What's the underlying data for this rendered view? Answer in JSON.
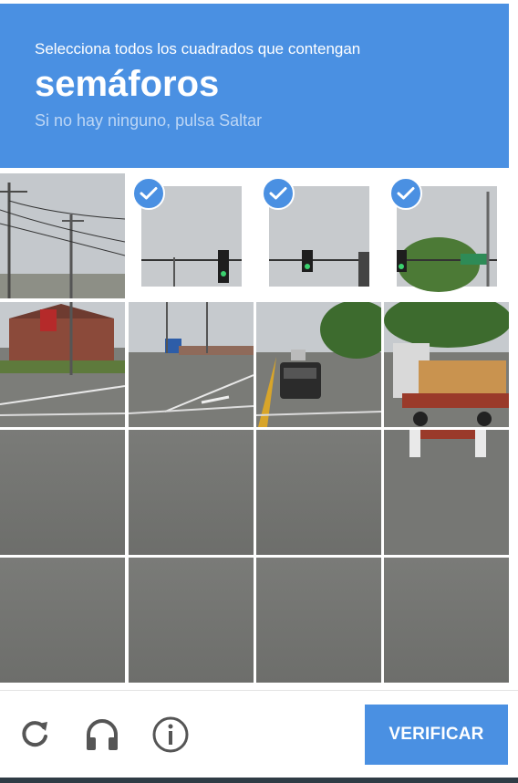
{
  "header": {
    "instruction": "Selecciona todos los cuadrados que contengan",
    "target": "semáforos",
    "hint": "Si no hay ninguno, pulsa Saltar"
  },
  "grid": {
    "rows": 4,
    "cols": 4,
    "selected_tiles": [
      1,
      2,
      3
    ]
  },
  "icons": {
    "reload": "reload-icon",
    "audio": "headphones-icon",
    "info": "info-icon",
    "check": "checkmark-icon"
  },
  "footer": {
    "verify_label": "VERIFICAR"
  },
  "colors": {
    "accent": "#4a90e2"
  }
}
